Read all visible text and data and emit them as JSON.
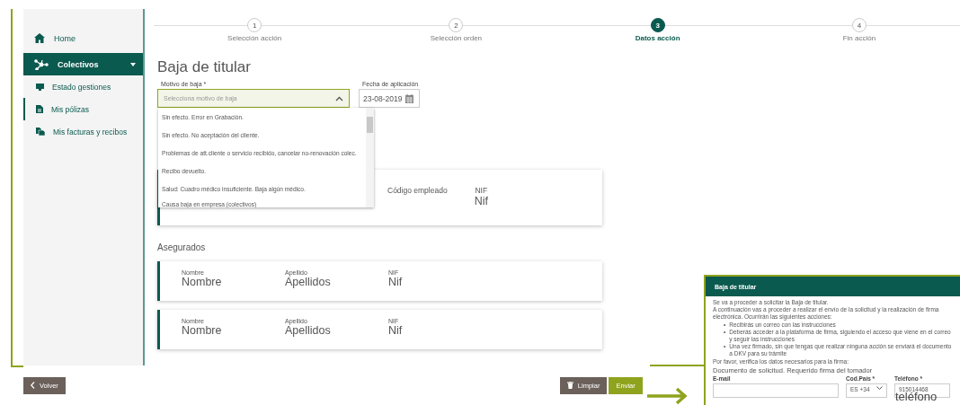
{
  "sidebar": {
    "items": [
      {
        "label": "Home",
        "kind": "link",
        "selected": false
      },
      {
        "label": "Colectivos",
        "kind": "group",
        "selected": true,
        "expanded": true,
        "children": [
          {
            "label": "Estado gestiones",
            "selected": false
          },
          {
            "label": "Mis pólizas",
            "selected": true
          },
          {
            "label": "Mis facturas y recibos",
            "selected": false
          }
        ]
      }
    ]
  },
  "stepper": {
    "steps": [
      {
        "number": "1",
        "label": "Selección acción",
        "selected": false
      },
      {
        "number": "2",
        "label": "Selección orden",
        "selected": false
      },
      {
        "number": "3",
        "label": "Datos acción",
        "selected": true
      },
      {
        "number": "4",
        "label": "Fin acción",
        "selected": false
      }
    ]
  },
  "form": {
    "title": "Baja de titular",
    "motivo": {
      "label": "Motivo de baja *",
      "placeholder": "Selecciona motivo de baja",
      "expanded": true,
      "options": [
        "Sin efecto. Error en Grabación.",
        "Sin efecto. No aceptación del cliente.",
        "Problemas de att.cliente o servicio recibido, cancelar no-renovación colec.",
        "Recibo devuelto.",
        "Salud: Cuadro médico insuficiente. Baja algún médico.",
        "Causa baja en empresa (colectivos)"
      ]
    },
    "fecha": {
      "label": "Fecha de aplicación",
      "value": "23-08-2019"
    }
  },
  "titular_card": {
    "fields": [
      {
        "label": "Código empleado"
      },
      {
        "label": "NIF",
        "value": "Nif"
      }
    ]
  },
  "asegurados": {
    "title": "Asegurados",
    "rows": [
      {
        "fields": [
          {
            "label": "Nombre",
            "value": "Nombre"
          },
          {
            "label": "Apellido",
            "value": "Apellidos"
          },
          {
            "label": "NIF",
            "value": "Nif"
          }
        ]
      },
      {
        "fields": [
          {
            "label": "Nombre",
            "value": "Nombre"
          },
          {
            "label": "Apellido",
            "value": "Apellidos"
          },
          {
            "label": "NIF",
            "value": "Nif"
          }
        ]
      }
    ]
  },
  "footer": {
    "back": "Volver",
    "clear": "Limpiar",
    "send": "Enviar"
  },
  "dialog": {
    "title": "Baja de titular",
    "intro": [
      "Se va a proceder a solicitar la Baja de titular.",
      "A continuación vas a proceder a realizar el envío de la solicitud y la realización de firma electrónica. Ocurrirán las siguientes acciones:"
    ],
    "bullet_marker": "•",
    "bullets": [
      "Recibirás un correo con las instrucciones",
      "Deberás acceder a la plataforma de firma, siguiendo el acceso que viene en el correo y seguir las instrucciones",
      "Una vez firmado, sin que tengas que realizar ninguna acción se enviará el documento a DKV para su trámite"
    ],
    "note": "Por favor, verifica los datos necesarios para la firma:",
    "subtitle": "Documento de solicitud. Requerido firma del tomador",
    "email": {
      "label": "E-mail"
    },
    "country": {
      "label": "Cod.País *",
      "value": "ES +34"
    },
    "phone": {
      "label": "Teléfono *",
      "value": "915014468"
    },
    "caption": "teléfono"
  }
}
